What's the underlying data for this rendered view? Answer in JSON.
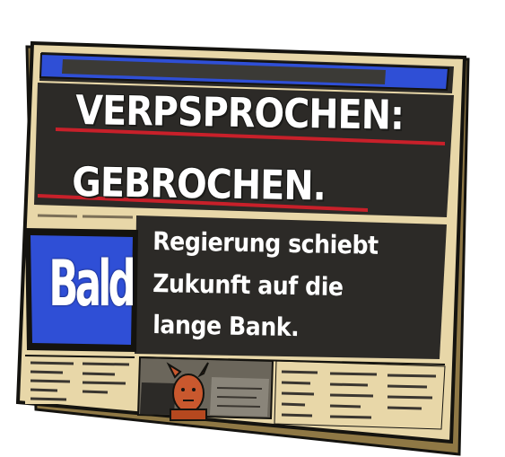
{
  "newspaper": {
    "headline": {
      "line1": "VERPSPROCHEN:",
      "line2": "GEBROCHEN."
    },
    "masthead": {
      "logo_text": "Bald"
    },
    "subheadline": {
      "line1": "Regierung schiebt",
      "line2": "Zukunft auf die",
      "line3": "lange Bank."
    }
  },
  "colors": {
    "paper": "#e8d7a8",
    "paper_shadow": "#b59a60",
    "dark_panel": "#2c2a27",
    "masthead_blue": "#2f4fd6",
    "accent_red": "#c8202a",
    "text_white": "#ffffff",
    "outline": "#14130f"
  },
  "icons": {
    "portrait": "cartoon-person-with-horns-icon"
  }
}
